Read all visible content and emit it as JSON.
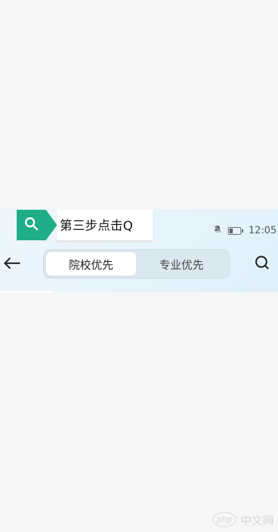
{
  "hint": {
    "icon": "search-icon",
    "text": "第三步点击Q",
    "accent": "#1fae88"
  },
  "status_bar": {
    "time": "12:05",
    "icons": [
      "mute-bell-icon",
      "battery-icon"
    ],
    "battery_level": 0.35
  },
  "nav": {
    "back_icon": "back-arrow-icon",
    "tabs": [
      {
        "label": "院校优先",
        "active": true
      },
      {
        "label": "专业优先",
        "active": false
      }
    ],
    "search_icon": "search-icon"
  },
  "watermark": {
    "text": "中文网",
    "logo_text": "php"
  }
}
